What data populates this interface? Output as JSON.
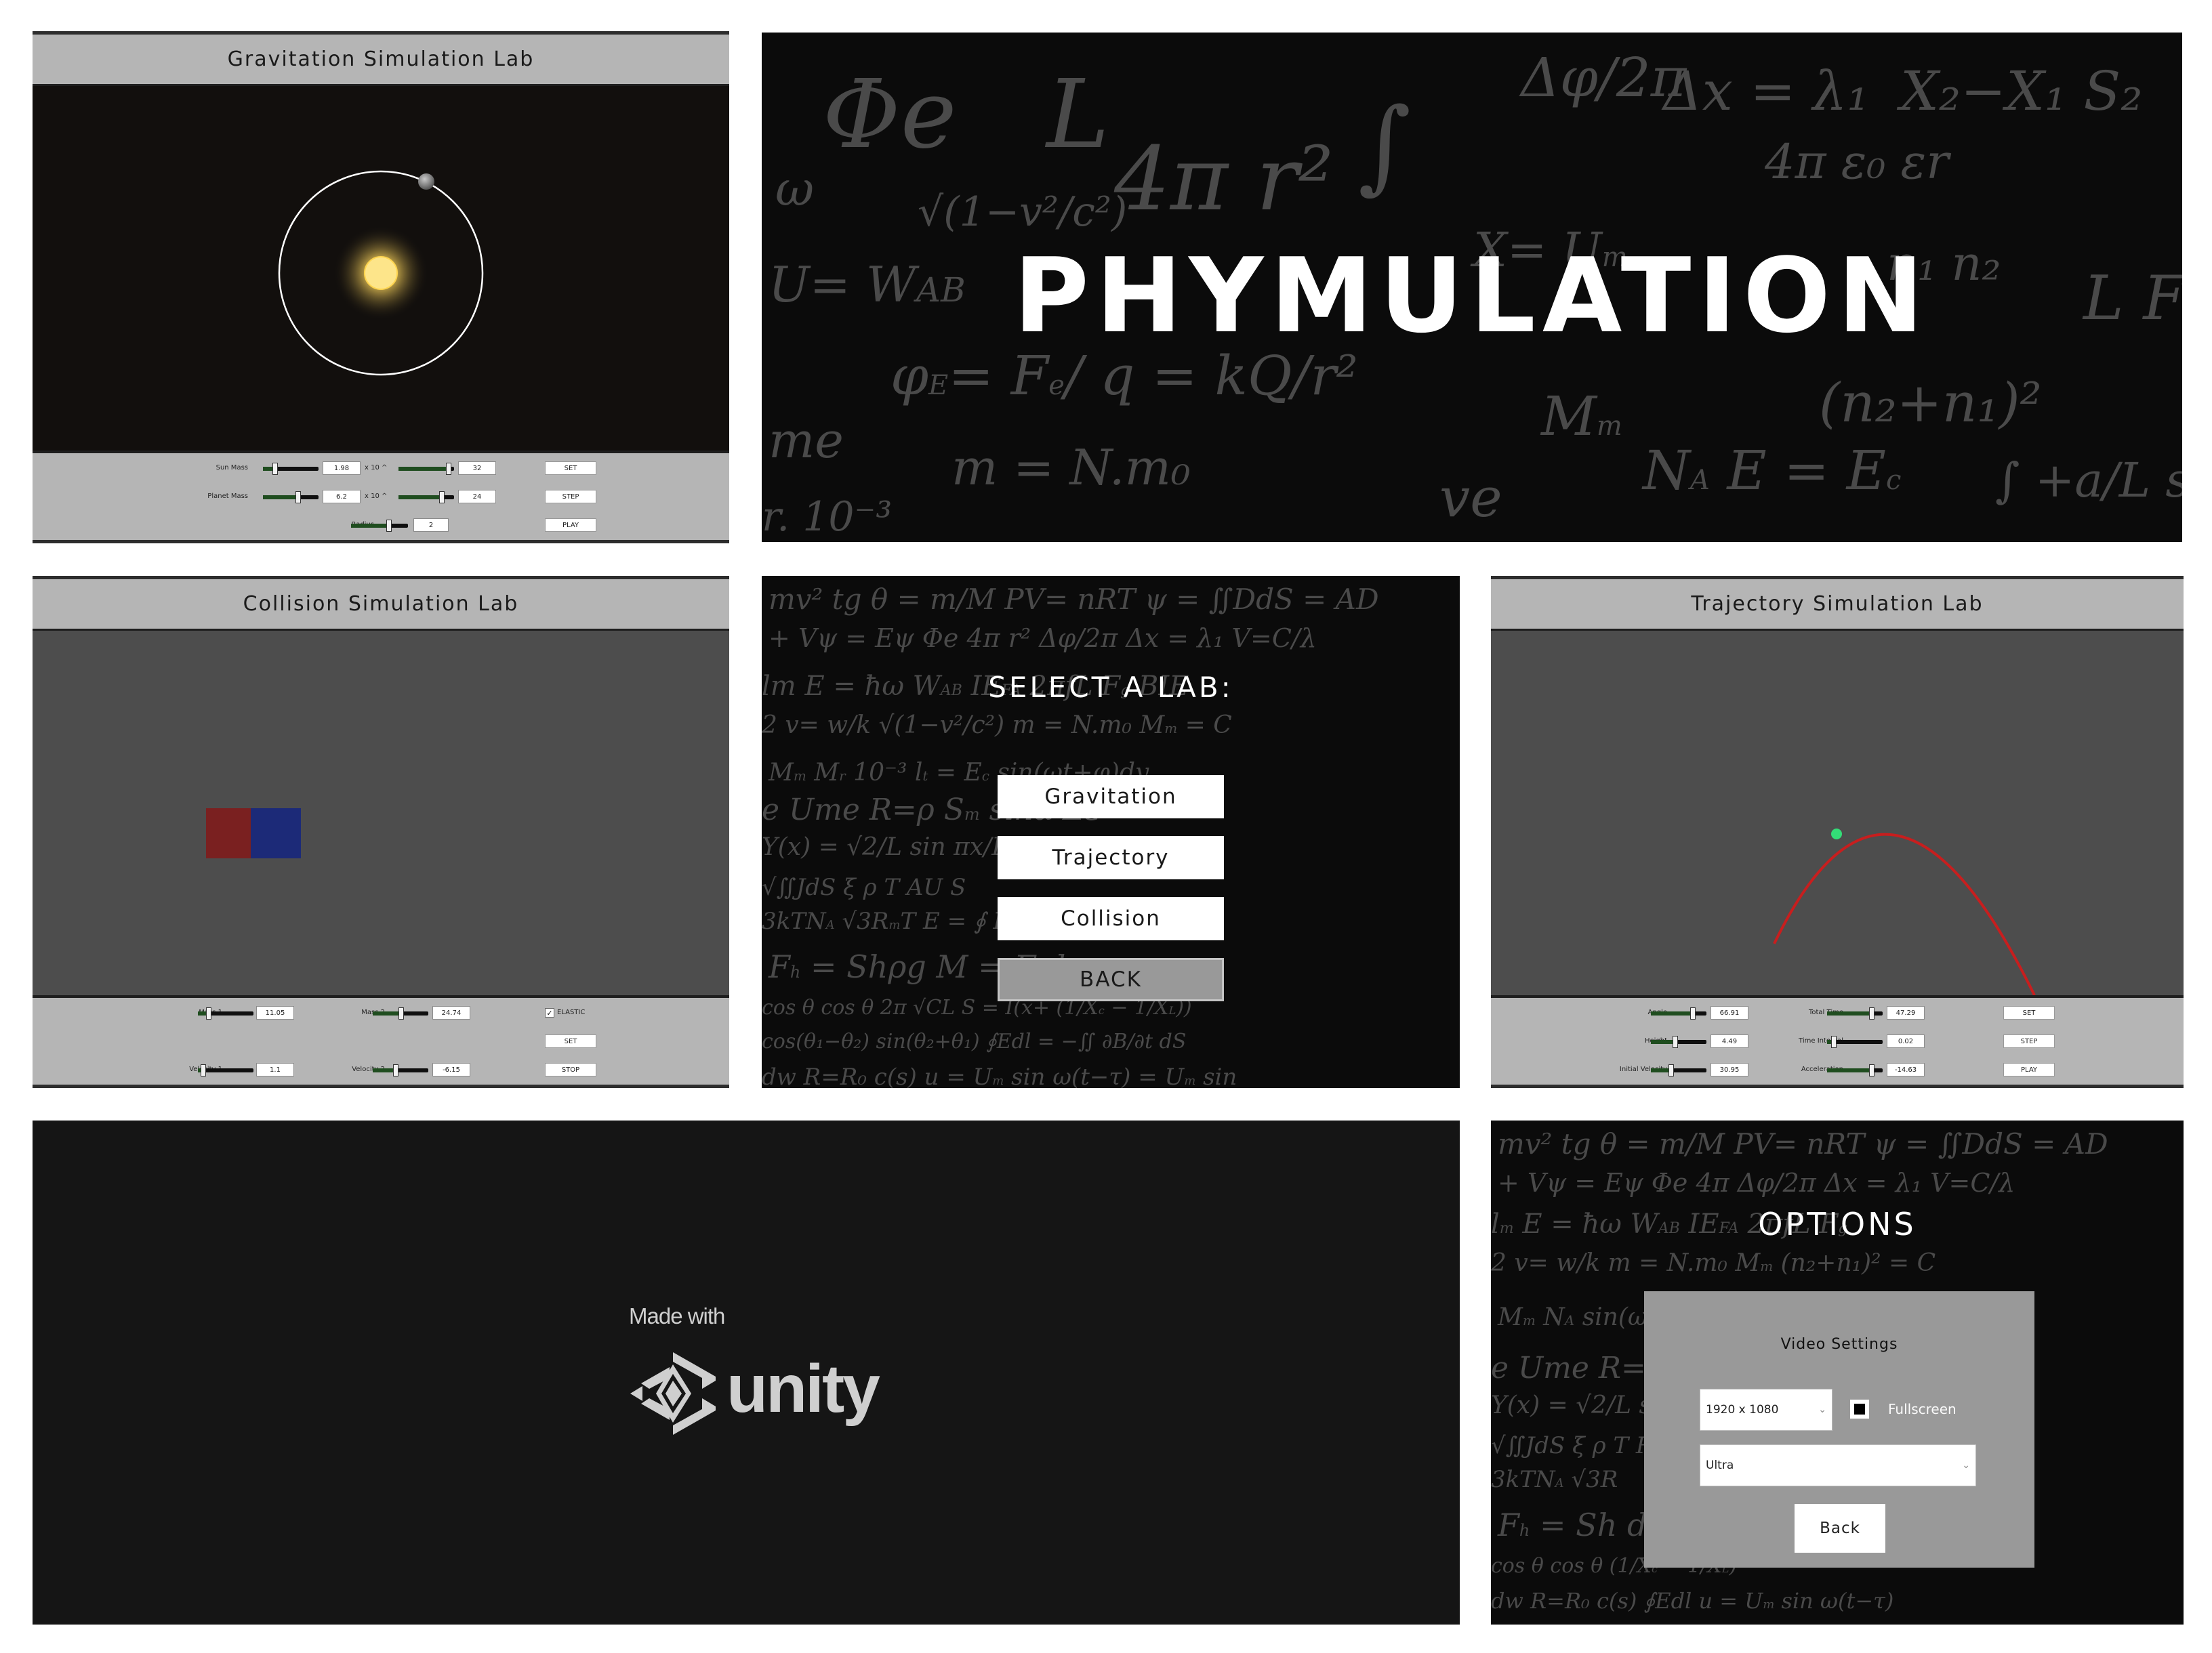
{
  "gravitation": {
    "title": "Gravitation Simulation Lab",
    "controls": {
      "sun_mass_label": "Sun Mass",
      "sun_mass_value": "1.98",
      "sun_exp_label": "x 10 ^",
      "sun_exp_value": "32",
      "planet_mass_label": "Planet Mass",
      "planet_mass_value": "6.2",
      "planet_exp_label": "x 10 ^",
      "planet_exp_value": "24",
      "radius_label": "Radius",
      "radius_value": "2",
      "set_label": "SET",
      "step_label": "STEP",
      "play_label": "PLAY"
    }
  },
  "title_screen": {
    "title": "PHYMULATION"
  },
  "collision": {
    "title": "Collision Simulation Lab",
    "colors": {
      "block_left": "#7a2020",
      "block_right": "#1c2a78"
    },
    "controls": {
      "mass1_label": "Mass 1",
      "mass1_value": "11.05",
      "mass2_label": "Mass 2",
      "mass2_value": "24.74",
      "elastic_label": "ELASTIC",
      "elastic_checked": true,
      "set_label": "SET",
      "velocity1_label": "Velocity 1",
      "velocity1_value": "1.1",
      "velocity2_label": "Velocity 2",
      "velocity2_value": "-6.15",
      "stop_label": "STOP"
    }
  },
  "select_lab": {
    "heading": "SELECT A LAB:",
    "buttons": [
      "Gravitation",
      "Trajectory",
      "Collision"
    ],
    "back_label": "BACK"
  },
  "trajectory": {
    "title": "Trajectory Simulation Lab",
    "colors": {
      "path": "#c81e1e",
      "ball": "#33dd77"
    },
    "controls": {
      "angle_label": "Angle",
      "angle_value": "66.91",
      "total_time_label": "Total Time",
      "total_time_value": "47.29",
      "height_label": "Height",
      "height_value": "4.49",
      "time_interval_label": "Time Interval",
      "time_interval_value": "0.02",
      "initial_velocity_label": "Initial Velocity",
      "initial_velocity_value": "30.95",
      "acceleration_label": "Acceleration",
      "acceleration_value": "-14.63",
      "set_label": "SET",
      "step_label": "STEP",
      "play_label": "PLAY"
    }
  },
  "splash": {
    "made_with": "Made with",
    "brand": "unity"
  },
  "options": {
    "heading": "OPTIONS",
    "section_title": "Video Settings",
    "resolution": "1920 x 1080",
    "fullscreen_label": "Fullscreen",
    "fullscreen_checked": true,
    "quality": "Ultra",
    "back_label": "Back"
  }
}
